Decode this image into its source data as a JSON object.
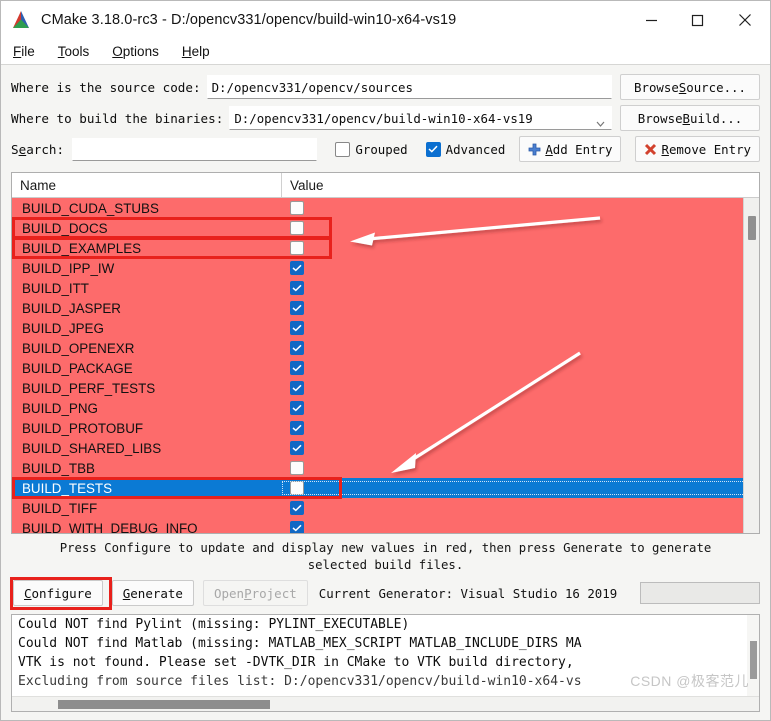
{
  "window": {
    "title": "CMake 3.18.0-rc3 - D:/opencv331/opencv/build-win10-x64-vs19",
    "logo_icon": "cmake-logo-icon",
    "minimize_icon": "minimize-icon",
    "maximize_icon": "maximize-icon",
    "close_icon": "close-icon"
  },
  "menu": {
    "items": [
      {
        "pre": "",
        "key": "F",
        "post": "ile"
      },
      {
        "pre": "",
        "key": "T",
        "post": "ools"
      },
      {
        "pre": "",
        "key": "O",
        "post": "ptions"
      },
      {
        "pre": "",
        "key": "H",
        "post": "elp"
      }
    ]
  },
  "form": {
    "source_label": "Where is the source code:",
    "source_value": "D:/opencv331/opencv/sources",
    "browse_source_pre": "Browse ",
    "browse_source_key": "S",
    "browse_source_post": "ource...",
    "build_label": "Where to build the binaries:",
    "build_value": "D:/opencv331/opencv/build-win10-x64-vs19",
    "browse_build_pre": "Browse ",
    "browse_build_key": "B",
    "browse_build_post": "uild...",
    "search_label_pre": "S",
    "search_label_key": "e",
    "search_label_post": "arch:",
    "search_value": "",
    "search_placeholder": "",
    "grouped_label": "Grouped",
    "grouped_checked": false,
    "advanced_label": "Advanced",
    "advanced_checked": true,
    "add_entry_pre": "",
    "add_entry_key": "A",
    "add_entry_post": "dd Entry",
    "add_entry_icon": "plus-icon",
    "remove_entry_pre": "",
    "remove_entry_key": "R",
    "remove_entry_post": "emove Entry",
    "remove_entry_icon": "x-mark-icon",
    "chevron_icon": "chevron-down-icon"
  },
  "table": {
    "col_name": "Name",
    "col_value": "Value",
    "rows": [
      {
        "name": "BUILD_CUDA_STUBS",
        "checked": false,
        "selected": false,
        "boxed": false
      },
      {
        "name": "BUILD_DOCS",
        "checked": false,
        "selected": false,
        "boxed": true
      },
      {
        "name": "BUILD_EXAMPLES",
        "checked": false,
        "selected": false,
        "boxed": true
      },
      {
        "name": "BUILD_IPP_IW",
        "checked": true,
        "selected": false,
        "boxed": false
      },
      {
        "name": "BUILD_ITT",
        "checked": true,
        "selected": false,
        "boxed": false
      },
      {
        "name": "BUILD_JASPER",
        "checked": true,
        "selected": false,
        "boxed": false
      },
      {
        "name": "BUILD_JPEG",
        "checked": true,
        "selected": false,
        "boxed": false
      },
      {
        "name": "BUILD_OPENEXR",
        "checked": true,
        "selected": false,
        "boxed": false
      },
      {
        "name": "BUILD_PACKAGE",
        "checked": true,
        "selected": false,
        "boxed": false
      },
      {
        "name": "BUILD_PERF_TESTS",
        "checked": true,
        "selected": false,
        "boxed": false
      },
      {
        "name": "BUILD_PNG",
        "checked": true,
        "selected": false,
        "boxed": false
      },
      {
        "name": "BUILD_PROTOBUF",
        "checked": true,
        "selected": false,
        "boxed": false
      },
      {
        "name": "BUILD_SHARED_LIBS",
        "checked": true,
        "selected": false,
        "boxed": false
      },
      {
        "name": "BUILD_TBB",
        "checked": false,
        "selected": false,
        "boxed": false
      },
      {
        "name": "BUILD_TESTS",
        "checked": false,
        "selected": true,
        "boxed": true
      },
      {
        "name": "BUILD_TIFF",
        "checked": true,
        "selected": false,
        "boxed": false
      },
      {
        "name": "BUILD_WITH_DEBUG_INFO",
        "checked": true,
        "selected": false,
        "boxed": false
      }
    ],
    "row_background_color": "#fd6b6b",
    "selected_row_color": "#0b7ad4",
    "annotation_color": "#e8211c"
  },
  "hint": {
    "line1": "Press Configure to update and display new values in red, then press Generate to generate",
    "line2": "selected build files."
  },
  "actions": {
    "configure_pre": "",
    "configure_key": "C",
    "configure_post": "onfigure",
    "generate_pre": "",
    "generate_key": "G",
    "generate_post": "enerate",
    "open_project_pre": "Open ",
    "open_project_key": "P",
    "open_project_post": "roject",
    "generator_text": "Current Generator: Visual Studio 16 2019",
    "progress_value": ""
  },
  "log": {
    "lines": [
      "Could NOT find Pylint (missing: PYLINT_EXECUTABLE)",
      "Could NOT find Matlab (missing: MATLAB_MEX_SCRIPT MATLAB_INCLUDE_DIRS MA",
      "VTK is not found. Please set -DVTK_DIR in CMake to VTK build directory, ",
      "Excluding from source files list: D:/opencv331/opencv/build-win10-x64-vs"
    ],
    "watermark": "CSDN @极客范儿"
  }
}
